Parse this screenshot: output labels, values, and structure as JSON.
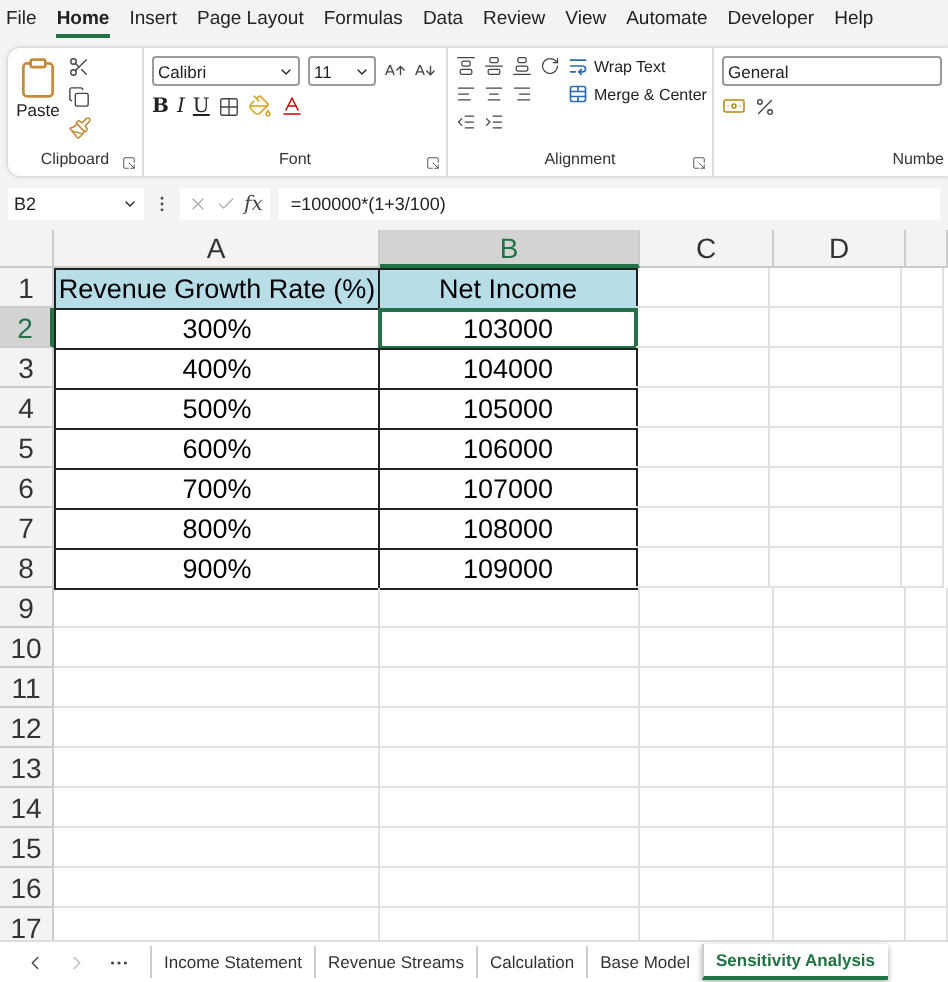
{
  "ribbon_tabs": [
    {
      "label": "File",
      "selected": false
    },
    {
      "label": "Home",
      "selected": true
    },
    {
      "label": "Insert",
      "selected": false
    },
    {
      "label": "Page Layout",
      "selected": false
    },
    {
      "label": "Formulas",
      "selected": false
    },
    {
      "label": "Data",
      "selected": false
    },
    {
      "label": "Review",
      "selected": false
    },
    {
      "label": "View",
      "selected": false
    },
    {
      "label": "Automate",
      "selected": false
    },
    {
      "label": "Developer",
      "selected": false
    },
    {
      "label": "Help",
      "selected": false
    }
  ],
  "ribbon": {
    "clipboard": {
      "label": "Clipboard",
      "paste": "Paste"
    },
    "font": {
      "label": "Font",
      "name": "Calibri",
      "size": "11",
      "bold": "B",
      "italic": "I",
      "underline": "U"
    },
    "alignment": {
      "label": "Alignment",
      "wrap": "Wrap Text",
      "merge": "Merge & Center"
    },
    "number": {
      "label": "Numbe",
      "format": "General"
    }
  },
  "formula_bar": {
    "name_box": "B2",
    "function_label": "fx",
    "formula": "=100000*(1+3/100)"
  },
  "columns": [
    {
      "label": "A",
      "selected": false
    },
    {
      "label": "B",
      "selected": true
    },
    {
      "label": "C",
      "selected": false
    },
    {
      "label": "D",
      "selected": false
    }
  ],
  "row_numbers": [
    {
      "label": "1",
      "selected": false
    },
    {
      "label": "2",
      "selected": true
    },
    {
      "label": "3",
      "selected": false
    },
    {
      "label": "4",
      "selected": false
    },
    {
      "label": "5",
      "selected": false
    },
    {
      "label": "6",
      "selected": false
    },
    {
      "label": "7",
      "selected": false
    },
    {
      "label": "8",
      "selected": false
    },
    {
      "label": "9",
      "selected": false
    },
    {
      "label": "10",
      "selected": false
    },
    {
      "label": "11",
      "selected": false
    },
    {
      "label": "12",
      "selected": false
    },
    {
      "label": "13",
      "selected": false
    },
    {
      "label": "14",
      "selected": false
    },
    {
      "label": "15",
      "selected": false
    },
    {
      "label": "16",
      "selected": false
    },
    {
      "label": "17",
      "selected": false
    }
  ],
  "table": {
    "header": [
      "Revenue Growth Rate (%)",
      "Net Income"
    ],
    "rows": [
      [
        {
          "text": "300%",
          "selected": false
        },
        {
          "text": "103000",
          "selected": true
        }
      ],
      [
        {
          "text": "400%",
          "selected": false
        },
        {
          "text": "104000",
          "selected": false
        }
      ],
      [
        {
          "text": "500%",
          "selected": false
        },
        {
          "text": "105000",
          "selected": false
        }
      ],
      [
        {
          "text": "600%",
          "selected": false
        },
        {
          "text": "106000",
          "selected": false
        }
      ],
      [
        {
          "text": "700%",
          "selected": false
        },
        {
          "text": "107000",
          "selected": false
        }
      ],
      [
        {
          "text": "800%",
          "selected": false
        },
        {
          "text": "108000",
          "selected": false
        }
      ],
      [
        {
          "text": "900%",
          "selected": false
        },
        {
          "text": "109000",
          "selected": false
        }
      ]
    ]
  },
  "sheet_tabs": [
    {
      "label": "Income Statement",
      "selected": false
    },
    {
      "label": "Revenue Streams",
      "selected": false
    },
    {
      "label": "Calculation",
      "selected": false
    },
    {
      "label": "Base Model",
      "selected": false
    },
    {
      "label": "Sensitivity Analysis",
      "selected": true
    }
  ]
}
